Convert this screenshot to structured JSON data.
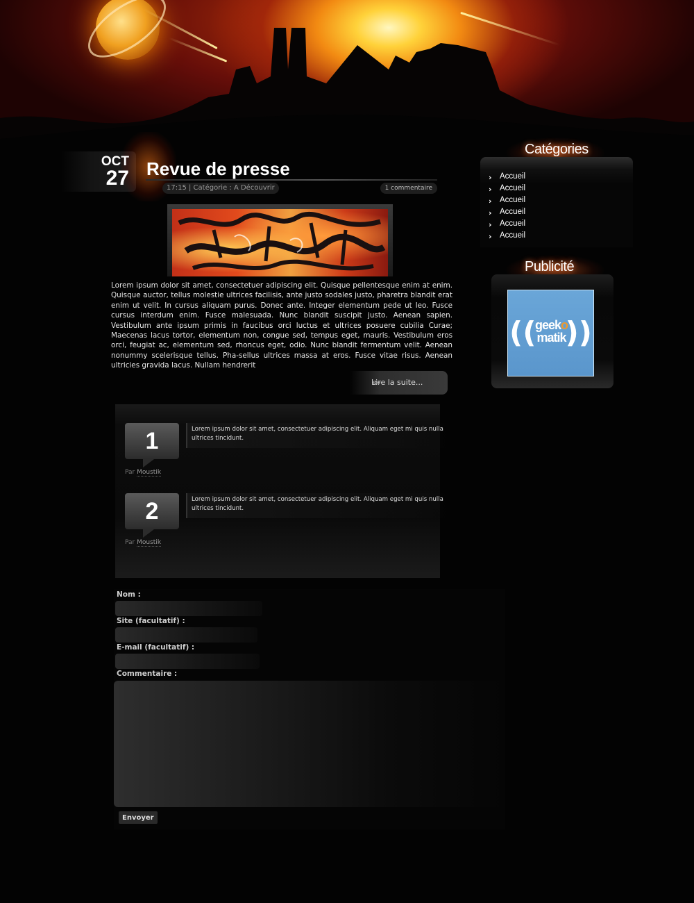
{
  "post": {
    "date_month": "OCT",
    "date_day": "27",
    "title": "Revue de presse",
    "meta": "17:15 | Catégorie : A Découvrir",
    "comment_count": "1 commentaire",
    "body": "Lorem ipsum dolor sit amet, consectetuer adipiscing elit. Quisque pellentesque enim at enim. Quisque auctor, tellus molestie ultrices facilisis, ante justo sodales justo, pharetra blandit erat enim ut velit. In cursus aliquam purus. Donec ante. Integer elementum pede ut leo. Fusce cursus interdum enim. Fusce malesuada. Nunc blandit suscipit justo. Aenean sapien. Vestibulum ante ipsum primis in faucibus orci luctus et ultrices posuere cubilia Curae; Maecenas lacus tortor, elementum non, congue sed, tempus eget, mauris. Vestibulum eros orci, feugiat ac, elementum sed, rhoncus eget, odio. Nunc blandit fermentum velit. Aenean nonummy scelerisque tellus. Pha-sellus ultrices massa at eros. Fusce vitae risus. Aenean ultricies gravida lacus. Nullam hendrerit",
    "read_more": "Lire la suite..."
  },
  "comments": [
    {
      "number": "1",
      "author_prefix": "Par",
      "author": "Moustik",
      "text": "Lorem ipsum dolor sit amet, consectetuer adipiscing elit. Aliquam eget mi quis nulla ultrices tincidunt."
    },
    {
      "number": "2",
      "author_prefix": "Par",
      "author": "Moustik",
      "text": "Lorem ipsum dolor sit amet, consectetuer adipiscing elit. Aliquam eget mi quis nulla ultrices tincidunt."
    }
  ],
  "form": {
    "name_label": "Nom :",
    "site_label": "Site (facultatif) :",
    "email_label": "E-mail (facultatif) :",
    "comment_label": "Commentaire :",
    "submit_label": "Envoyer"
  },
  "sidebar": {
    "categories_title": "Catégories",
    "categories": [
      "Accueil",
      "Accueil",
      "Accueil",
      "Accueil",
      "Accueil",
      "Accueil"
    ],
    "ads_title": "Publicité",
    "ad": {
      "line1_a": "geek",
      "line1_b": "o",
      "line2": "matik"
    }
  },
  "colors": {
    "background": "#030303",
    "accent_fire": "#f28a12",
    "ad_blue": "#5a96cc"
  }
}
